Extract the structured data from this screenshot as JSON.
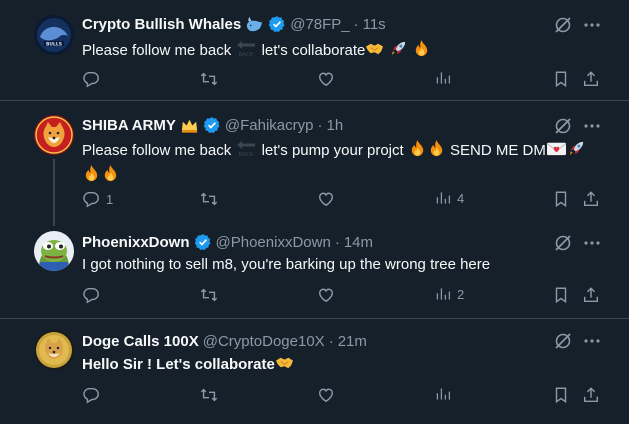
{
  "tweets": [
    {
      "name": "Crypto Bullish Whales",
      "badge_icon": "whale-emoji-icon",
      "handle": "@78FP_",
      "separator": "·",
      "time": "11s",
      "text_a": "Please follow me back",
      "text_b": "let's collaborate",
      "emojis": [
        "handshake-icon",
        "rocket-icon",
        "fire-icon"
      ],
      "replies": "",
      "views": ""
    },
    {
      "name": "SHIBA ARMY",
      "badge_icon": "crown-emoji-icon",
      "handle": "@Fahikacryp",
      "separator": "·",
      "time": "1h",
      "text_a": "Please follow me back",
      "text_b": "let's pump your projct",
      "text_c": "SEND ME DM",
      "replies": "1",
      "views": "4"
    },
    {
      "name": "PhoenixxDown",
      "handle": "@PhoenixxDown",
      "separator": "·",
      "time": "14m",
      "text_a": "I got nothing to sell m8, you're barking up the wrong tree here",
      "replies": "",
      "views": "2"
    },
    {
      "name": "Doge Calls 100X",
      "handle": "@CryptoDoge10X",
      "separator": "·",
      "time": "21m",
      "text_a": "Hello Sir ! Let's collaborate",
      "replies": "",
      "views": ""
    }
  ],
  "colors": {
    "background": "#15202b",
    "text": "#f7f9f9",
    "muted": "#8b98a5",
    "verified": "#1d9bf0",
    "divider": "#38444d"
  },
  "icons": {
    "reply": "reply-icon",
    "retweet": "retweet-icon",
    "like": "heart-icon",
    "views": "views-icon",
    "bookmark": "bookmark-icon",
    "share": "share-icon",
    "grok": "grok-icon",
    "more": "more-icon",
    "back_arrow": "back-arrow-emoji-icon"
  }
}
